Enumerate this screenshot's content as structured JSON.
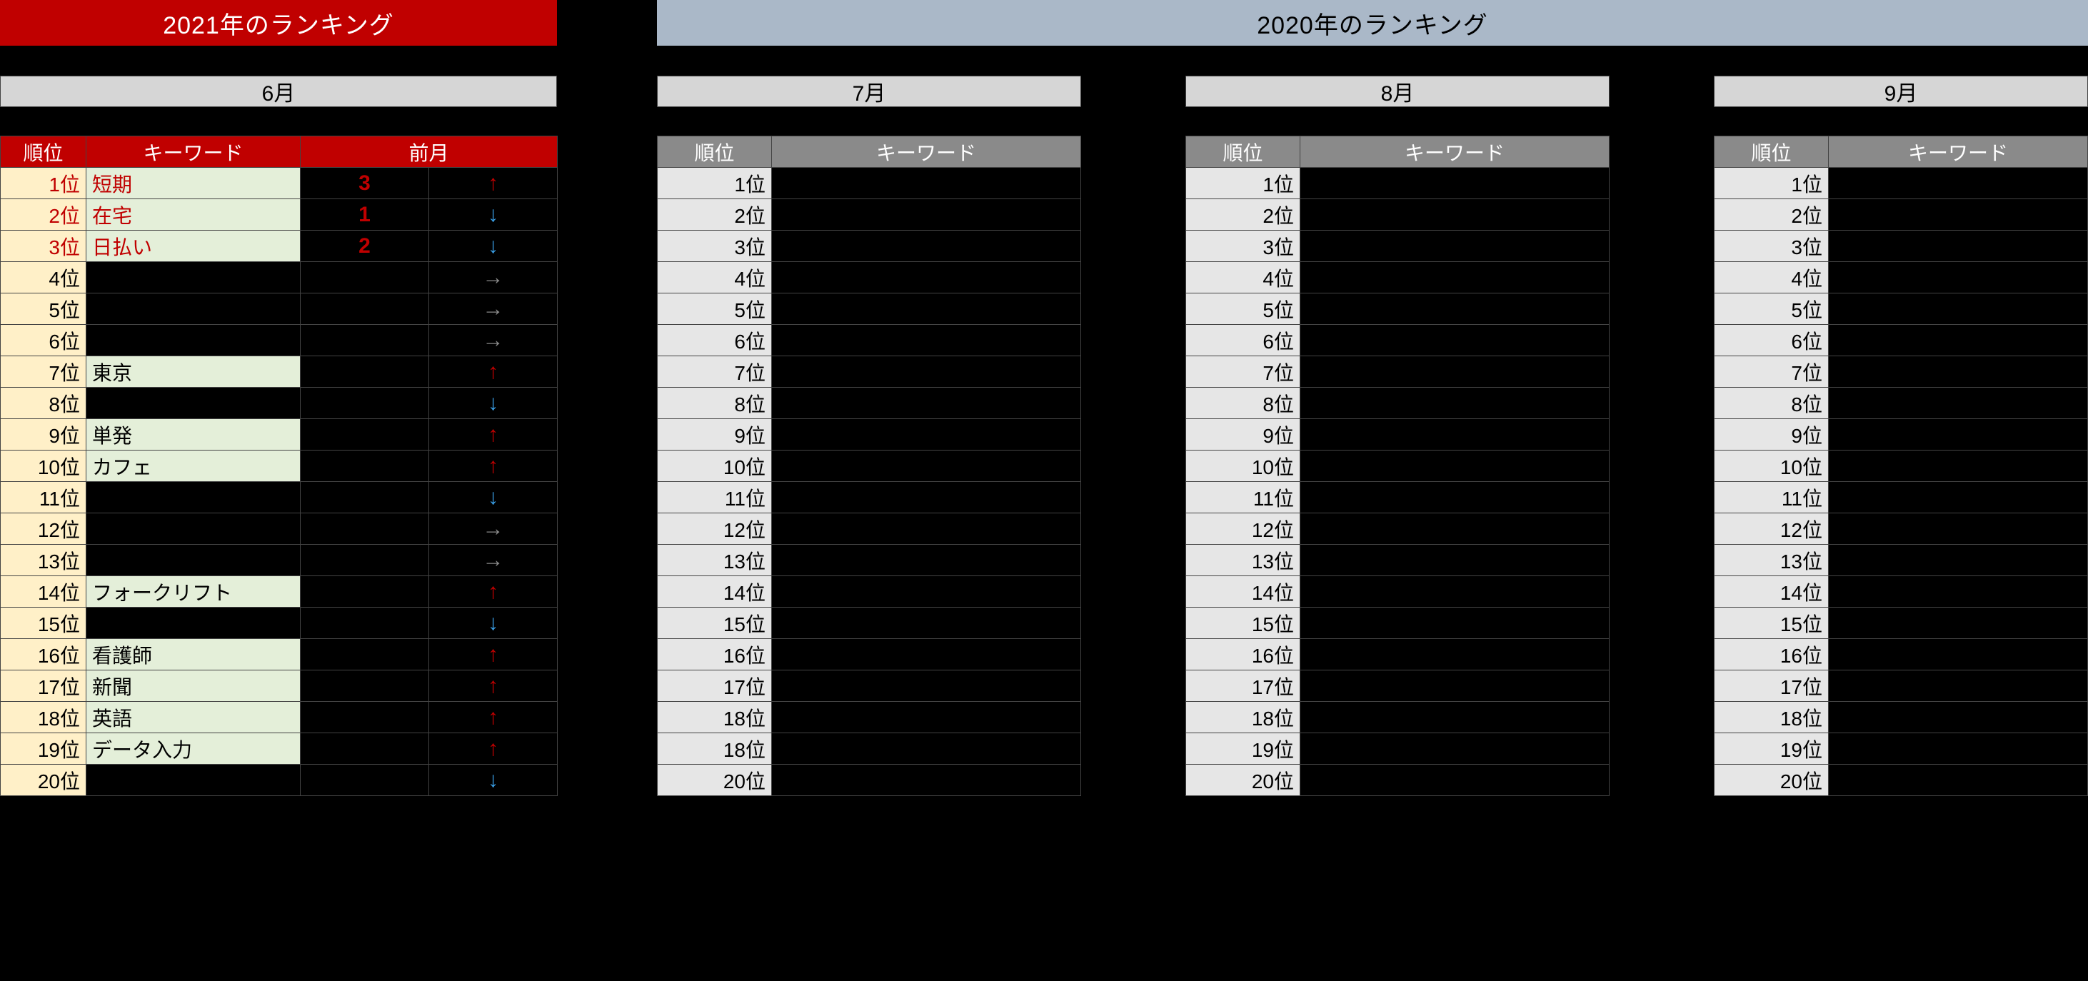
{
  "year_header_2021": "2021年のランキング",
  "year_header_2020": "2020年のランキング",
  "labels": {
    "rank": "順位",
    "keyword": "キーワード",
    "prev": "前月"
  },
  "months": {
    "m6": "6月",
    "m7": "7月",
    "m8": "8月",
    "m9": "9月"
  },
  "arrows": {
    "up": "↑",
    "down": "↓",
    "same": "→"
  },
  "ranking_2021_06": [
    {
      "rank": "1位",
      "keyword": "短期",
      "prev": "3",
      "move": "up",
      "top3": true
    },
    {
      "rank": "2位",
      "keyword": "在宅",
      "prev": "1",
      "move": "down",
      "top3": true
    },
    {
      "rank": "3位",
      "keyword": "日払い",
      "prev": "2",
      "move": "down",
      "top3": true
    },
    {
      "rank": "4位",
      "keyword": "",
      "prev": "",
      "move": "same"
    },
    {
      "rank": "5位",
      "keyword": "",
      "prev": "",
      "move": "same"
    },
    {
      "rank": "6位",
      "keyword": "",
      "prev": "",
      "move": "same"
    },
    {
      "rank": "7位",
      "keyword": "東京",
      "prev": "",
      "move": "up"
    },
    {
      "rank": "8位",
      "keyword": "",
      "prev": "",
      "move": "down"
    },
    {
      "rank": "9位",
      "keyword": "単発",
      "prev": "",
      "move": "up"
    },
    {
      "rank": "10位",
      "keyword": "カフェ",
      "prev": "",
      "move": "up"
    },
    {
      "rank": "11位",
      "keyword": "",
      "prev": "",
      "move": "down"
    },
    {
      "rank": "12位",
      "keyword": "",
      "prev": "",
      "move": "same"
    },
    {
      "rank": "13位",
      "keyword": "",
      "prev": "",
      "move": "same"
    },
    {
      "rank": "14位",
      "keyword": "フォークリフト",
      "prev": "",
      "move": "up"
    },
    {
      "rank": "15位",
      "keyword": "",
      "prev": "",
      "move": "down"
    },
    {
      "rank": "16位",
      "keyword": "看護師",
      "prev": "",
      "move": "up"
    },
    {
      "rank": "17位",
      "keyword": "新聞",
      "prev": "",
      "move": "up"
    },
    {
      "rank": "18位",
      "keyword": "英語",
      "prev": "",
      "move": "up"
    },
    {
      "rank": "19位",
      "keyword": "データ入力",
      "prev": "",
      "move": "up"
    },
    {
      "rank": "20位",
      "keyword": "",
      "prev": "",
      "move": "down"
    }
  ],
  "ranking_2020_07_ranks": [
    "1位",
    "2位",
    "3位",
    "4位",
    "5位",
    "6位",
    "7位",
    "8位",
    "9位",
    "10位",
    "11位",
    "12位",
    "13位",
    "14位",
    "15位",
    "16位",
    "17位",
    "18位",
    "18位",
    "20位"
  ],
  "ranking_2020_08_ranks": [
    "1位",
    "2位",
    "3位",
    "4位",
    "5位",
    "6位",
    "7位",
    "8位",
    "9位",
    "10位",
    "11位",
    "12位",
    "13位",
    "14位",
    "15位",
    "16位",
    "17位",
    "18位",
    "19位",
    "20位"
  ],
  "ranking_2020_09_ranks": [
    "1位",
    "2位",
    "3位",
    "4位",
    "5位",
    "6位",
    "7位",
    "8位",
    "9位",
    "10位",
    "11位",
    "12位",
    "13位",
    "14位",
    "15位",
    "16位",
    "17位",
    "18位",
    "19位",
    "20位"
  ]
}
